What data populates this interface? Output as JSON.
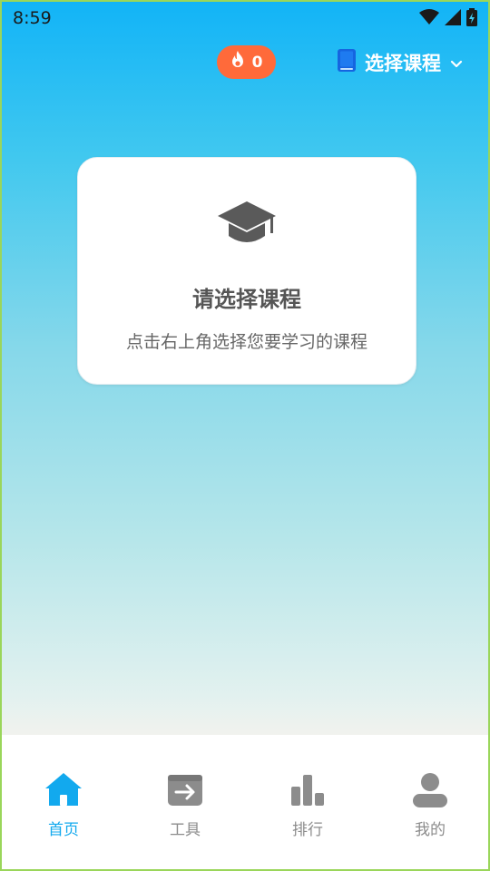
{
  "status_bar": {
    "time": "8:59",
    "icons": [
      "wifi-icon",
      "signal-icon",
      "battery-charging-icon"
    ]
  },
  "header": {
    "streak_count": "0",
    "streak_icon": "flame-icon",
    "course_select_label": "选择课程",
    "course_icon": "book-icon",
    "dropdown_icon": "chevron-down-icon"
  },
  "card": {
    "icon": "graduation-cap-icon",
    "title": "请选择课程",
    "subtitle": "点击右上角选择您要学习的课程"
  },
  "bottom_nav": {
    "items": [
      {
        "label": "首页",
        "icon": "home-icon",
        "active": true
      },
      {
        "label": "工具",
        "icon": "tools-icon",
        "active": false
      },
      {
        "label": "排行",
        "icon": "ranking-icon",
        "active": false
      },
      {
        "label": "我的",
        "icon": "profile-icon",
        "active": false
      }
    ]
  },
  "colors": {
    "accent": "#12a9ee",
    "streak_badge": "#ff6a3a",
    "inactive_icon": "#8c8c8c"
  }
}
